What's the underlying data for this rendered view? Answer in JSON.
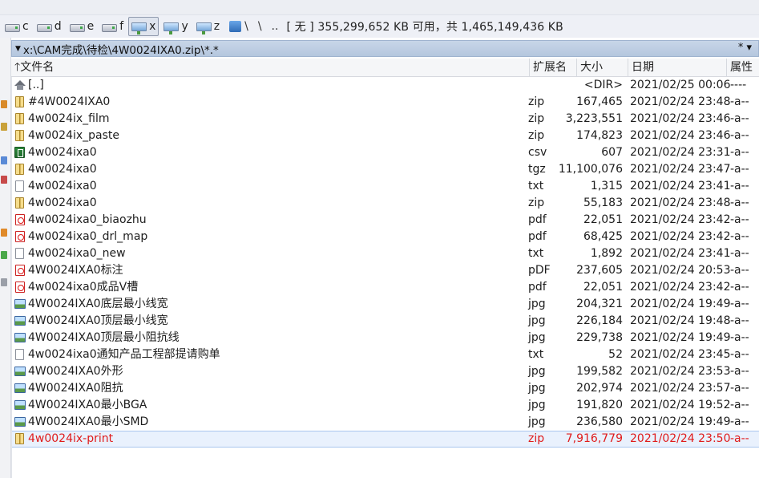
{
  "drives": [
    {
      "letter": "c",
      "icon": "hdd-icon",
      "active": false
    },
    {
      "letter": "d",
      "icon": "hdd-icon",
      "active": false
    },
    {
      "letter": "e",
      "icon": "hdd-icon",
      "active": false
    },
    {
      "letter": "f",
      "icon": "hdd-icon",
      "active": false
    },
    {
      "letter": "x",
      "icon": "network-drive-icon",
      "active": true
    },
    {
      "letter": "y",
      "icon": "network-drive-icon",
      "active": false
    },
    {
      "letter": "z",
      "icon": "network-drive-icon",
      "active": false
    }
  ],
  "drivebar": {
    "root_symbol": "\\",
    "back_symbol": "\\",
    "up_symbol": "..",
    "free_space_text": "[ 无 ]  355,299,652 KB 可用，共 1,465,149,436 KB"
  },
  "path": {
    "text": "x:\\CAM完成\\待检\\4W0024IXA0.zip\\*.*",
    "filter_symbol": "*  ▾"
  },
  "columns": {
    "name": "文件名",
    "ext": "扩展名",
    "size": "大小",
    "date": "日期",
    "attr": "属性"
  },
  "files": [
    {
      "name": "[..]",
      "ext": "",
      "size": "<DIR>",
      "date": "2021/02/25 00:06",
      "attr": "----",
      "icon": "up-folder-icon"
    },
    {
      "name": "#4W0024IXA0",
      "ext": "zip",
      "size": "167,465",
      "date": "2021/02/24 23:48",
      "attr": "-a--",
      "icon": "zip-icon"
    },
    {
      "name": "4w0024ix_film",
      "ext": "zip",
      "size": "3,223,551",
      "date": "2021/02/24 23:46",
      "attr": "-a--",
      "icon": "zip-icon"
    },
    {
      "name": "4w0024ix_paste",
      "ext": "zip",
      "size": "174,823",
      "date": "2021/02/24 23:46",
      "attr": "-a--",
      "icon": "zip-icon"
    },
    {
      "name": "4w0024ixa0",
      "ext": "csv",
      "size": "607",
      "date": "2021/02/24 23:31",
      "attr": "-a--",
      "icon": "csv-icon"
    },
    {
      "name": "4w0024ixa0",
      "ext": "tgz",
      "size": "11,100,076",
      "date": "2021/02/24 23:47",
      "attr": "-a--",
      "icon": "zip-icon"
    },
    {
      "name": "4w0024ixa0",
      "ext": "txt",
      "size": "1,315",
      "date": "2021/02/24 23:41",
      "attr": "-a--",
      "icon": "txt-icon"
    },
    {
      "name": "4w0024ixa0",
      "ext": "zip",
      "size": "55,183",
      "date": "2021/02/24 23:48",
      "attr": "-a--",
      "icon": "zip-icon"
    },
    {
      "name": "4w0024ixa0_biaozhu",
      "ext": "pdf",
      "size": "22,051",
      "date": "2021/02/24 23:42",
      "attr": "-a--",
      "icon": "pdf-icon"
    },
    {
      "name": "4w0024ixa0_drl_map",
      "ext": "pdf",
      "size": "68,425",
      "date": "2021/02/24 23:42",
      "attr": "-a--",
      "icon": "pdf-icon"
    },
    {
      "name": "4w0024ixa0_new",
      "ext": "txt",
      "size": "1,892",
      "date": "2021/02/24 23:41",
      "attr": "-a--",
      "icon": "txt-icon"
    },
    {
      "name": "4W0024IXA0标注",
      "ext": "pDF",
      "size": "237,605",
      "date": "2021/02/24 20:53",
      "attr": "-a--",
      "icon": "pdf-icon"
    },
    {
      "name": "4w0024ixa0成品V槽",
      "ext": "pdf",
      "size": "22,051",
      "date": "2021/02/24 23:42",
      "attr": "-a--",
      "icon": "pdf-icon"
    },
    {
      "name": "4W0024IXA0底层最小线宽",
      "ext": "jpg",
      "size": "204,321",
      "date": "2021/02/24 19:49",
      "attr": "-a--",
      "icon": "image-icon"
    },
    {
      "name": "4W0024IXA0顶层最小线宽",
      "ext": "jpg",
      "size": "226,184",
      "date": "2021/02/24 19:48",
      "attr": "-a--",
      "icon": "image-icon"
    },
    {
      "name": "4W0024IXA0顶层最小阻抗线",
      "ext": "jpg",
      "size": "229,738",
      "date": "2021/02/24 19:49",
      "attr": "-a--",
      "icon": "image-icon"
    },
    {
      "name": "4w0024ixa0通知产品工程部提请购单",
      "ext": "txt",
      "size": "52",
      "date": "2021/02/24 23:45",
      "attr": "-a--",
      "icon": "txt-icon"
    },
    {
      "name": "4W0024IXA0外形",
      "ext": "jpg",
      "size": "199,582",
      "date": "2021/02/24 23:53",
      "attr": "-a--",
      "icon": "image-icon"
    },
    {
      "name": "4W0024IXA0阻抗",
      "ext": "jpg",
      "size": "202,974",
      "date": "2021/02/24 23:57",
      "attr": "-a--",
      "icon": "image-icon"
    },
    {
      "name": "4W0024IXA0最小BGA",
      "ext": "jpg",
      "size": "191,820",
      "date": "2021/02/24 19:52",
      "attr": "-a--",
      "icon": "image-icon"
    },
    {
      "name": "4W0024IXA0最小SMD",
      "ext": "jpg",
      "size": "236,580",
      "date": "2021/02/24 19:49",
      "attr": "-a--",
      "icon": "image-icon"
    },
    {
      "name": "4w0024ix-print",
      "ext": "zip",
      "size": "7,916,779",
      "date": "2021/02/24 23:50",
      "attr": "-a--",
      "icon": "zip-icon",
      "selected": true
    }
  ],
  "colors": {
    "selected_text": "#e01b1b",
    "path_bar": "#bccbe0"
  }
}
